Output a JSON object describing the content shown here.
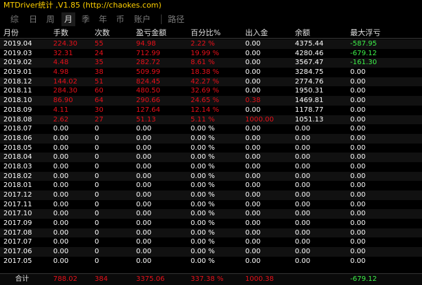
{
  "app": {
    "title": "MTDriver统计 ,V1.85 (http://chaokes.com)"
  },
  "tabs": [
    "综",
    "日",
    "周",
    "月",
    "季",
    "年",
    "币",
    "账户",
    "路径"
  ],
  "active_tab": "月",
  "columns": [
    "月份",
    "手数",
    "次数",
    "盈亏金额",
    "百分比%",
    "出入金",
    "余额",
    "最大浮亏"
  ],
  "rows": [
    {
      "month": "2019.04",
      "lots": "224.30",
      "count": "55",
      "pnl": "94.98",
      "pct": "2.22 %",
      "io": "0.00",
      "bal": "4375.44",
      "dd": "-587.95"
    },
    {
      "month": "2019.03",
      "lots": "32.31",
      "count": "24",
      "pnl": "712.99",
      "pct": "19.99 %",
      "io": "0.00",
      "bal": "4280.46",
      "dd": "-679.12"
    },
    {
      "month": "2019.02",
      "lots": "4.48",
      "count": "35",
      "pnl": "282.72",
      "pct": "8.61 %",
      "io": "0.00",
      "bal": "3567.47",
      "dd": "-161.30"
    },
    {
      "month": "2019.01",
      "lots": "4.98",
      "count": "38",
      "pnl": "509.99",
      "pct": "18.38 %",
      "io": "0.00",
      "bal": "3284.75",
      "dd": "0.00"
    },
    {
      "month": "2018.12",
      "lots": "144.02",
      "count": "51",
      "pnl": "824.45",
      "pct": "42.27 %",
      "io": "0.00",
      "bal": "2774.76",
      "dd": "0.00"
    },
    {
      "month": "2018.11",
      "lots": "284.30",
      "count": "60",
      "pnl": "480.50",
      "pct": "32.69 %",
      "io": "0.00",
      "bal": "1950.31",
      "dd": "0.00"
    },
    {
      "month": "2018.10",
      "lots": "86.90",
      "count": "64",
      "pnl": "290.66",
      "pct": "24.65 %",
      "io": "0.38",
      "bal": "1469.81",
      "dd": "0.00"
    },
    {
      "month": "2018.09",
      "lots": "4.11",
      "count": "30",
      "pnl": "127.64",
      "pct": "12.14 %",
      "io": "0.00",
      "bal": "1178.77",
      "dd": "0.00"
    },
    {
      "month": "2018.08",
      "lots": "2.62",
      "count": "27",
      "pnl": "51.13",
      "pct": "5.11 %",
      "io": "1000.00",
      "bal": "1051.13",
      "dd": "0.00"
    },
    {
      "month": "2018.07",
      "lots": "0.00",
      "count": "0",
      "pnl": "0.00",
      "pct": "0.00 %",
      "io": "0.00",
      "bal": "0.00",
      "dd": "0.00"
    },
    {
      "month": "2018.06",
      "lots": "0.00",
      "count": "0",
      "pnl": "0.00",
      "pct": "0.00 %",
      "io": "0.00",
      "bal": "0.00",
      "dd": "0.00"
    },
    {
      "month": "2018.05",
      "lots": "0.00",
      "count": "0",
      "pnl": "0.00",
      "pct": "0.00 %",
      "io": "0.00",
      "bal": "0.00",
      "dd": "0.00"
    },
    {
      "month": "2018.04",
      "lots": "0.00",
      "count": "0",
      "pnl": "0.00",
      "pct": "0.00 %",
      "io": "0.00",
      "bal": "0.00",
      "dd": "0.00"
    },
    {
      "month": "2018.03",
      "lots": "0.00",
      "count": "0",
      "pnl": "0.00",
      "pct": "0.00 %",
      "io": "0.00",
      "bal": "0.00",
      "dd": "0.00"
    },
    {
      "month": "2018.02",
      "lots": "0.00",
      "count": "0",
      "pnl": "0.00",
      "pct": "0.00 %",
      "io": "0.00",
      "bal": "0.00",
      "dd": "0.00"
    },
    {
      "month": "2018.01",
      "lots": "0.00",
      "count": "0",
      "pnl": "0.00",
      "pct": "0.00 %",
      "io": "0.00",
      "bal": "0.00",
      "dd": "0.00"
    },
    {
      "month": "2017.12",
      "lots": "0.00",
      "count": "0",
      "pnl": "0.00",
      "pct": "0.00 %",
      "io": "0.00",
      "bal": "0.00",
      "dd": "0.00"
    },
    {
      "month": "2017.11",
      "lots": "0.00",
      "count": "0",
      "pnl": "0.00",
      "pct": "0.00 %",
      "io": "0.00",
      "bal": "0.00",
      "dd": "0.00"
    },
    {
      "month": "2017.10",
      "lots": "0.00",
      "count": "0",
      "pnl": "0.00",
      "pct": "0.00 %",
      "io": "0.00",
      "bal": "0.00",
      "dd": "0.00"
    },
    {
      "month": "2017.09",
      "lots": "0.00",
      "count": "0",
      "pnl": "0.00",
      "pct": "0.00 %",
      "io": "0.00",
      "bal": "0.00",
      "dd": "0.00"
    },
    {
      "month": "2017.08",
      "lots": "0.00",
      "count": "0",
      "pnl": "0.00",
      "pct": "0.00 %",
      "io": "0.00",
      "bal": "0.00",
      "dd": "0.00"
    },
    {
      "month": "2017.07",
      "lots": "0.00",
      "count": "0",
      "pnl": "0.00",
      "pct": "0.00 %",
      "io": "0.00",
      "bal": "0.00",
      "dd": "0.00"
    },
    {
      "month": "2017.06",
      "lots": "0.00",
      "count": "0",
      "pnl": "0.00",
      "pct": "0.00 %",
      "io": "0.00",
      "bal": "0.00",
      "dd": "0.00"
    },
    {
      "month": "2017.05",
      "lots": "0.00",
      "count": "0",
      "pnl": "0.00",
      "pct": "0.00 %",
      "io": "0.00",
      "bal": "0.00",
      "dd": "0.00"
    }
  ],
  "total": {
    "label": "合计",
    "lots": "788.02",
    "count": "384",
    "pnl": "3375.06",
    "pct": "337.38 %",
    "io": "1000.38",
    "bal": "",
    "dd": "-679.12"
  },
  "colors": {
    "title": "#ffd000",
    "profit": "#e8101a",
    "drawdown": "#3ef34a",
    "zero": "#ffffff",
    "background": "#000000"
  }
}
